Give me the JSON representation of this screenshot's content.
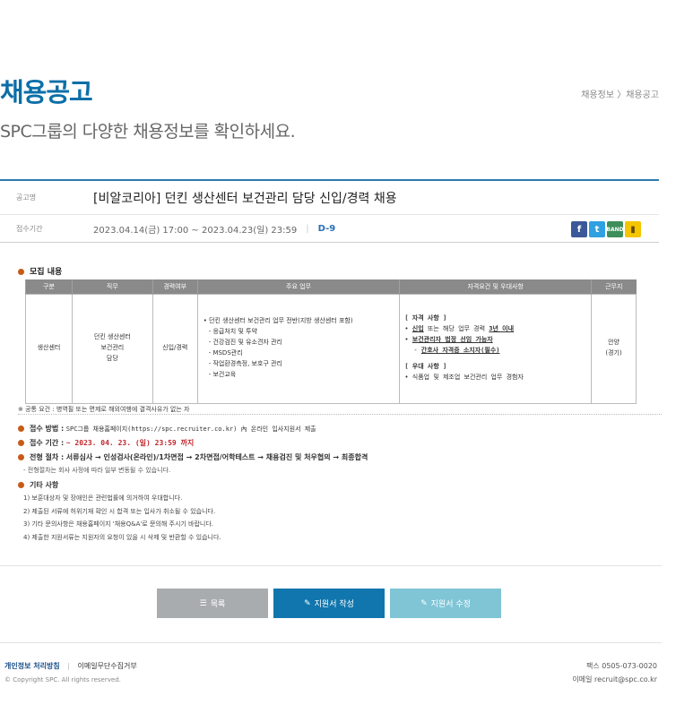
{
  "header": {
    "title": "채용공고",
    "subtitle": "SPC그룹의 다양한 채용정보를 확인하세요.",
    "breadcrumb": "채용정보 〉채용공고"
  },
  "posting": {
    "name_label": "공고명",
    "name": "[비알코리아] 던킨 생산센터 보건관리 담당 신입/경력 채용",
    "period_label": "접수기간",
    "period": "2023.04.14(금) 17:00 ~ 2023.04.23(일) 23:59",
    "dday": "D-9",
    "share": {
      "facebook": "f",
      "twitter": "t",
      "band": "BAND",
      "kakaostory": "ks"
    }
  },
  "recruit": {
    "section_title": "모집 내용",
    "headers": [
      "구분",
      "직무",
      "경력여부",
      "주요 업무",
      "자격요건 및 우대사항",
      "근무지"
    ],
    "row": {
      "category": "생산센터",
      "job": [
        "던킨 생산센터",
        "보건관리",
        "담당"
      ],
      "career": "신입/경력",
      "duties": [
        "• 던킨 생산센터 보건관리 업무 전반(지방 생산센터 포함)",
        "- 응급처치 및 투약",
        "- 건강검진 및 유소견자 관리",
        "- MSDS관리",
        "- 작업환경측정, 보호구 관리",
        "- 보건교육"
      ],
      "qual_title": "[ 자격 사항 ]",
      "qual_1a": "• ",
      "qual_1b": "신입",
      "qual_1c": " 또는 해당 업무 경력 ",
      "qual_1d": "3년 이내",
      "qual_2": "보건관리자 법정 선임 가능자",
      "qual_3": "간호사 자격증 소지자(필수)",
      "pref_title": "[ 우대 사항 ]",
      "pref_1": "• 식품업 및 제조업 보건관리 업무 경험자",
      "location": [
        "안양",
        "(경기)"
      ]
    }
  },
  "note": "※ 공통 요건 : 병역필 또는 면제로 해외여행에 결격사유가 없는 자",
  "apply": {
    "method_label": "접수 방법 :",
    "method": "SPC그룹 채용홈페이지(https://spc.recruiter.co.kr) 內 온라인 입사지원서 제출",
    "period_label": "접수 기간 :",
    "period": "~ 2023. 04. 23. (일) 23:59 까지",
    "process_label": "전형 절차 :",
    "process": "서류심사  →  인성검사(온라인)/1차면접  →  2차면접/어학테스트  →  채용검진 및 처우협의  →  최종합격",
    "process_note": "- 전형절차는 회사 사정에 따라 일부 변동될 수 있습니다."
  },
  "etc": {
    "title": "기타 사항",
    "items": [
      "1) 보훈대상자 및 장애인은 관련법률에 의거하여 우대합니다.",
      "2) 제출된 서류에 허위기재 확인 시 합격 또는 입사가 취소될 수 있습니다.",
      "3) 기타 문의사항은 채용홈페이지 '채용Q&A'로 문의해 주시기 바랍니다.",
      "4) 제출한 지원서류는 지원자의 요청이 있을 시 삭제 및 반환할 수 있습니다."
    ]
  },
  "buttons": {
    "list": "목록",
    "apply": "지원서 작성",
    "edit": "지원서 수정"
  },
  "footer": {
    "privacy": "개인정보 처리방침",
    "email_refuse": "이메일무단수집거부",
    "copyright": "© Copyright SPC. All rights reserved.",
    "fax": "팩스 0505-073-0020",
    "email": "이메일 recruit@spc.co.kr"
  }
}
